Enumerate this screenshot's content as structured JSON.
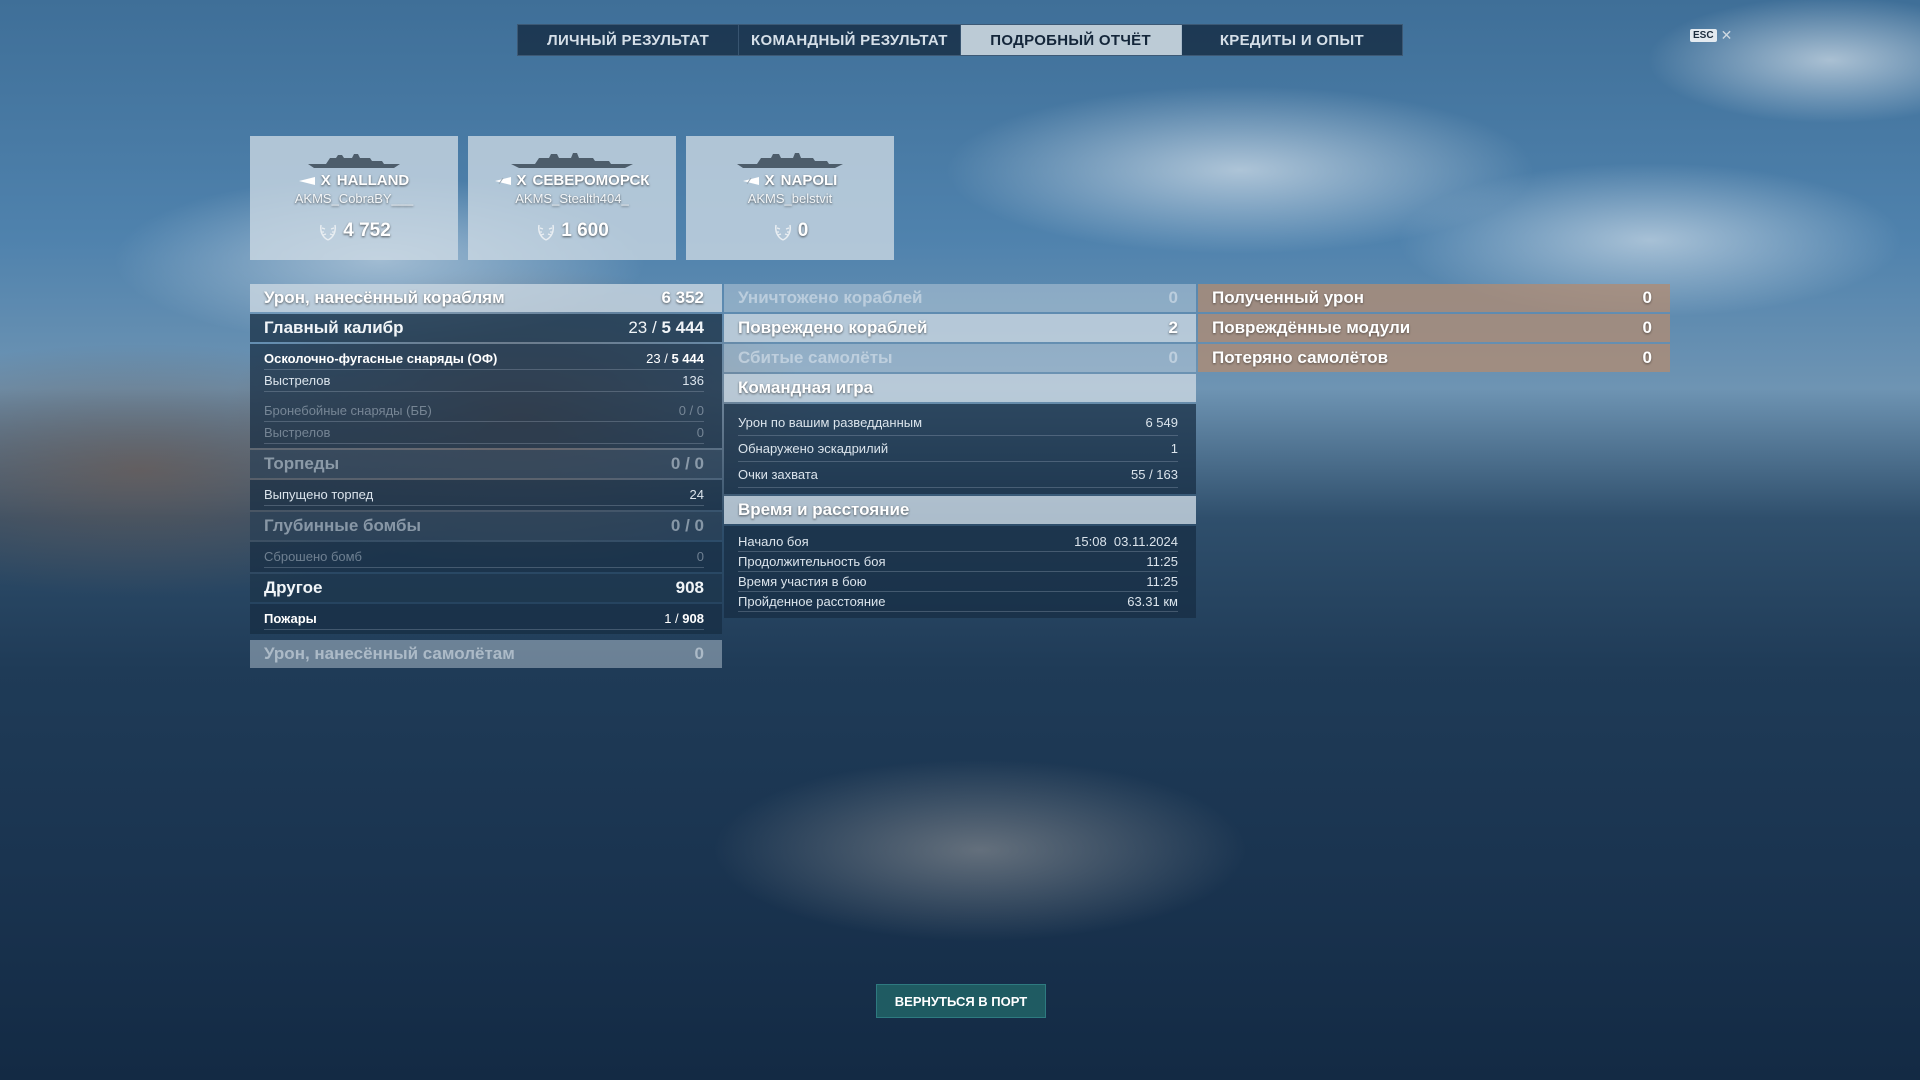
{
  "tabs": [
    {
      "label": "ЛИЧНЫЙ РЕЗУЛЬТАТ"
    },
    {
      "label": "КОМАНДНЫЙ РЕЗУЛЬТАТ"
    },
    {
      "label": "ПОДРОБНЫЙ ОТЧЁТ"
    },
    {
      "label": "КРЕДИТЫ И ОПЫТ"
    }
  ],
  "active_tab": "ПОДРОБНЫЙ ОТЧЁТ",
  "esc": {
    "key": "ESC",
    "close": "✕"
  },
  "cards": [
    {
      "tier": "X",
      "ship": "HALLAND",
      "player": "AKMS_CobraBY___",
      "score": "4 752"
    },
    {
      "tier": "X",
      "ship": "СЕВЕРОМОРСК",
      "player": "AKMS_Stealth404_",
      "score": "1 600"
    },
    {
      "tier": "X",
      "ship": "NAPOLI",
      "player": "AKMS_belstvit",
      "score": "0"
    }
  ],
  "left": {
    "damage_ships": {
      "label": "Урон, нанесённый кораблям",
      "value": "6 352"
    },
    "main_caliber": {
      "label": "Главный калибр",
      "hits": "23",
      "sep": "/",
      "damage": "5 444"
    },
    "he_shells": {
      "label": "Осколочно-фугасные снаряды (ОФ)",
      "hits": "23",
      "sep": "/",
      "damage": "5 444"
    },
    "he_shots": {
      "label": "Выстрелов",
      "value": "136"
    },
    "ap_shells": {
      "label": "Бронебойные снаряды (ББ)",
      "value": "0 / 0"
    },
    "ap_shots": {
      "label": "Выстрелов",
      "value": "0"
    },
    "torpedoes": {
      "label": "Торпеды",
      "value": "0 / 0"
    },
    "torpedoes_fired": {
      "label": "Выпущено торпед",
      "value": "24"
    },
    "depth_charges": {
      "label": "Глубинные бомбы",
      "value": "0 / 0"
    },
    "bombs_dropped": {
      "label": "Сброшено бомб",
      "value": "0"
    },
    "other": {
      "label": "Другое",
      "value": "908"
    },
    "fires": {
      "label": "Пожары",
      "hits": "1",
      "sep": "/",
      "damage": "908"
    },
    "damage_planes": {
      "label": "Урон, нанесённый самолётам",
      "value": "0"
    }
  },
  "middle": {
    "ships_destroyed": {
      "label": "Уничтожено кораблей",
      "value": "0"
    },
    "ships_damaged": {
      "label": "Повреждено кораблей",
      "value": "2"
    },
    "planes_shot": {
      "label": "Сбитые самолёты",
      "value": "0"
    },
    "teamplay": {
      "label": "Командная игра",
      "rows": [
        {
          "label": "Урон по вашим разведданным",
          "value": "6 549"
        },
        {
          "label": "Обнаружено эскадрилий",
          "value": "1"
        },
        {
          "label": "Очки захвата",
          "value": "55 / 163"
        }
      ]
    },
    "time": {
      "label": "Время и расстояние",
      "rows": [
        {
          "label": "Начало боя",
          "value": "15:08  03.11.2024"
        },
        {
          "label": "Продолжительность боя",
          "value": "11:25"
        },
        {
          "label": "Время участия в бою",
          "value": "11:25"
        },
        {
          "label": "Пройденное расстояние",
          "value": "63.31 км"
        }
      ]
    }
  },
  "right": {
    "damage_received": {
      "label": "Полученный урон",
      "value": "0"
    },
    "modules_damaged": {
      "label": "Повреждённые модули",
      "value": "0"
    },
    "planes_lost": {
      "label": "Потеряно самолётов",
      "value": "0"
    }
  },
  "back_button": "ВЕРНУТЬСЯ В ПОРТ"
}
